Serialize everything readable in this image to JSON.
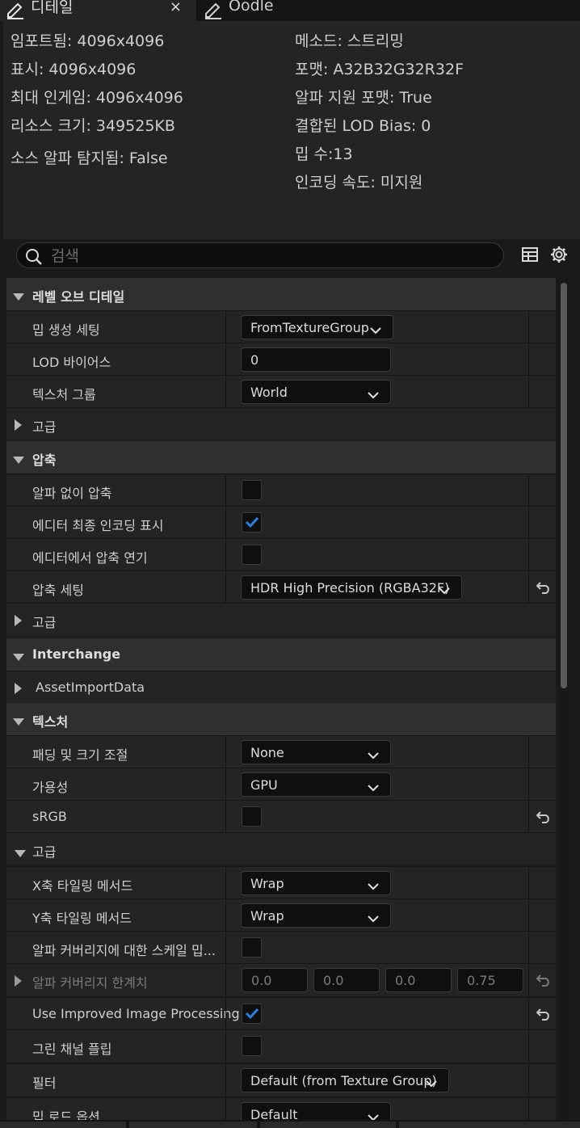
{
  "tabs": [
    {
      "label": "디테일",
      "icon": "pencil-icon",
      "active": true,
      "close": "×"
    },
    {
      "label": "Oodle",
      "icon": "pencil-icon",
      "active": false
    }
  ],
  "stats": {
    "left": [
      "임포트됨: 4096x4096",
      "표시: 4096x4096",
      "최대 인게임: 4096x4096",
      "리소스 크기: 349525KB",
      "소스 알파 탐지됨: False"
    ],
    "right": [
      "메소드: 스트리밍",
      "포맷: A32B32G32R32F",
      "알파 지원 포맷: True",
      "결합된 LOD Bias: 0",
      "밉 수:13",
      "인코딩 속도: 미지원"
    ]
  },
  "search": {
    "placeholder": "검색"
  },
  "toolbar": {
    "table_icon": "table-icon",
    "settings_icon": "gear-icon"
  },
  "sections": {
    "lod": {
      "title": "레벨 오브 디테일",
      "mip_gen": {
        "label": "밉 생성 세팅",
        "value": "FromTextureGroup"
      },
      "lod_bias": {
        "label": "LOD 바이어스",
        "value": "0"
      },
      "texture_group": {
        "label": "텍스처 그룹",
        "value": "World"
      },
      "advanced": "고급"
    },
    "compression": {
      "title": "압축",
      "no_alpha": {
        "label": "알파 없이 압축",
        "checked": false
      },
      "show_final": {
        "label": "에디터 최종 인코딩 표시",
        "checked": true
      },
      "defer": {
        "label": "에디터에서 압축 연기",
        "checked": false
      },
      "settings": {
        "label": "압축 세팅",
        "value": "HDR High Precision (RGBA32F)"
      },
      "advanced": "고급"
    },
    "interchange": {
      "title": "Interchange",
      "asset_import": "AssetImportData"
    },
    "texture": {
      "title": "텍스처",
      "padding": {
        "label": "패딩 및 크기 조절",
        "value": "None"
      },
      "availability": {
        "label": "가용성",
        "value": "GPU"
      },
      "srgb": {
        "label": "sRGB",
        "checked": false
      },
      "advanced": "고급",
      "x_tiling": {
        "label": "X축 타일링 메서드",
        "value": "Wrap"
      },
      "y_tiling": {
        "label": "Y축 타일링 메서드",
        "value": "Wrap"
      },
      "alpha_cov_scale": {
        "label": "알파 커버리지에 대한 스케일 밉...",
        "checked": false
      },
      "alpha_cov_thresh": {
        "label": "알파 커버리지 한계치",
        "values": [
          "0.0",
          "0.0",
          "0.0",
          "0.75"
        ]
      },
      "improved": {
        "label": "Use Improved Image Processing",
        "checked": true
      },
      "green_flip": {
        "label": "그린 채널 플립",
        "checked": false
      },
      "filter": {
        "label": "필터",
        "value": "Default (from Texture Group)"
      },
      "mip_load": {
        "label": "밉 로드 옵션",
        "value": "Default"
      }
    }
  },
  "colors": {
    "accent": "#2f7fe0",
    "panel": "#242424",
    "category": "#2f2f2f"
  }
}
